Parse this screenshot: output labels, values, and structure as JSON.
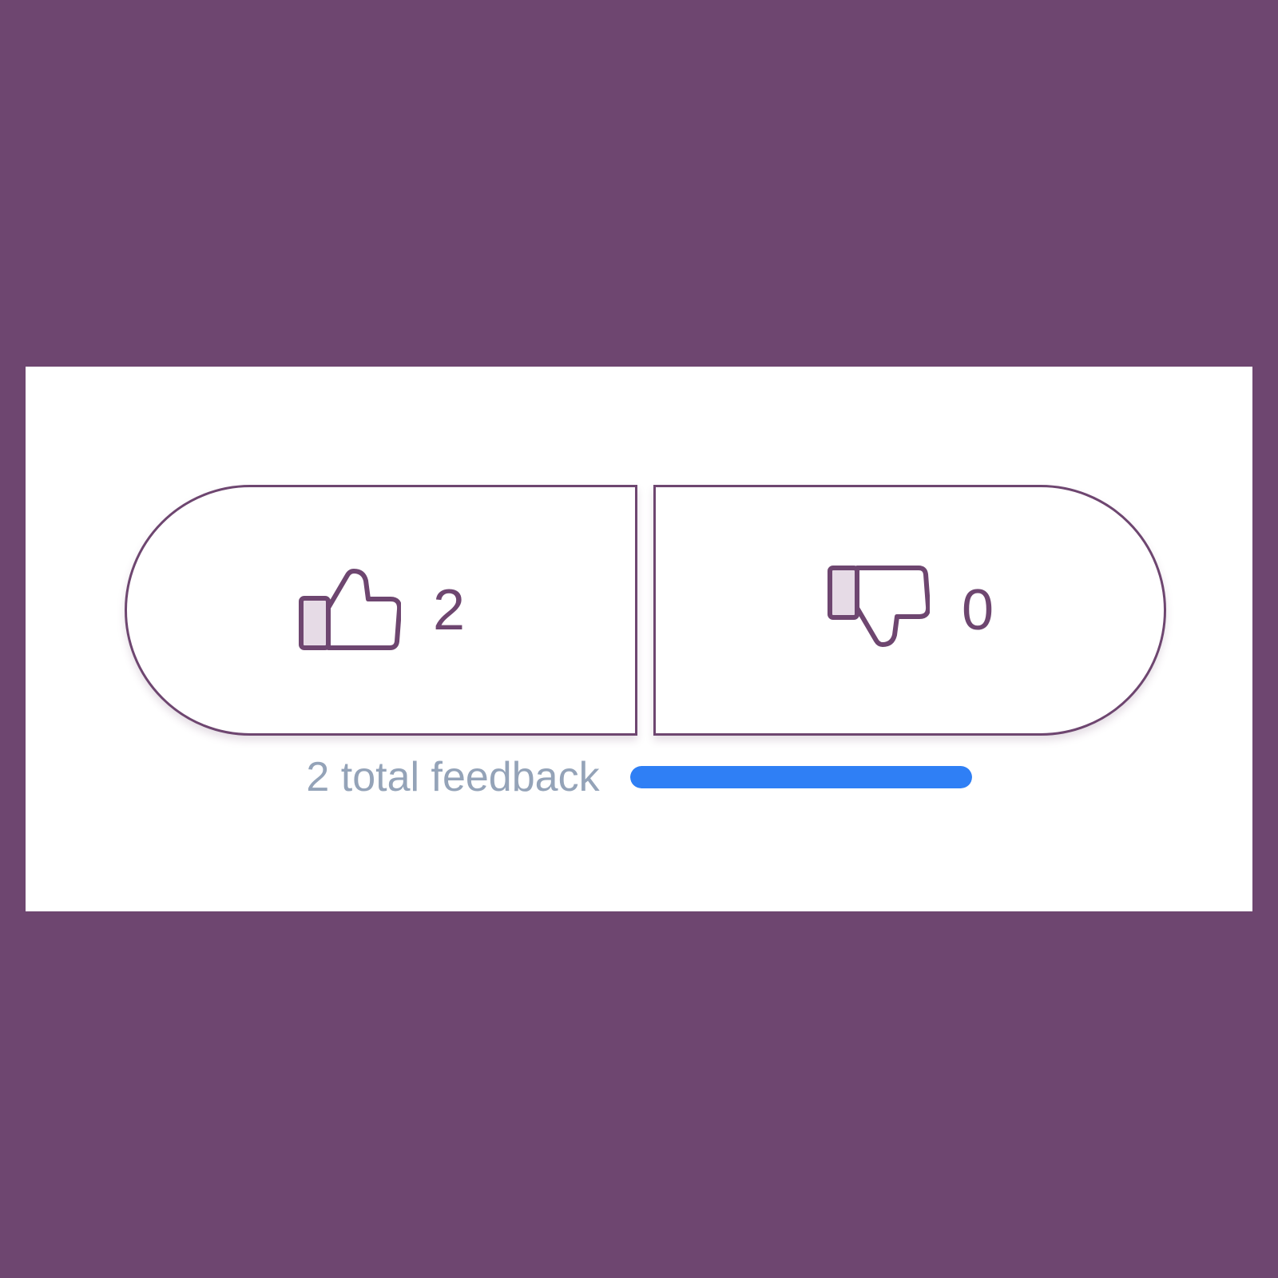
{
  "theme": {
    "background": "#6e4670",
    "accent": "#6e4670",
    "icon_fill": "#e6dbe6",
    "muted_text": "#94a3b8",
    "progress_color": "#2f7ff5"
  },
  "votes": {
    "up": {
      "icon": "thumbs-up-icon",
      "count": "2"
    },
    "down": {
      "icon": "thumbs-down-icon",
      "count": "0"
    }
  },
  "summary": {
    "text": "2 total feedback",
    "positive_fraction": 1.0
  }
}
